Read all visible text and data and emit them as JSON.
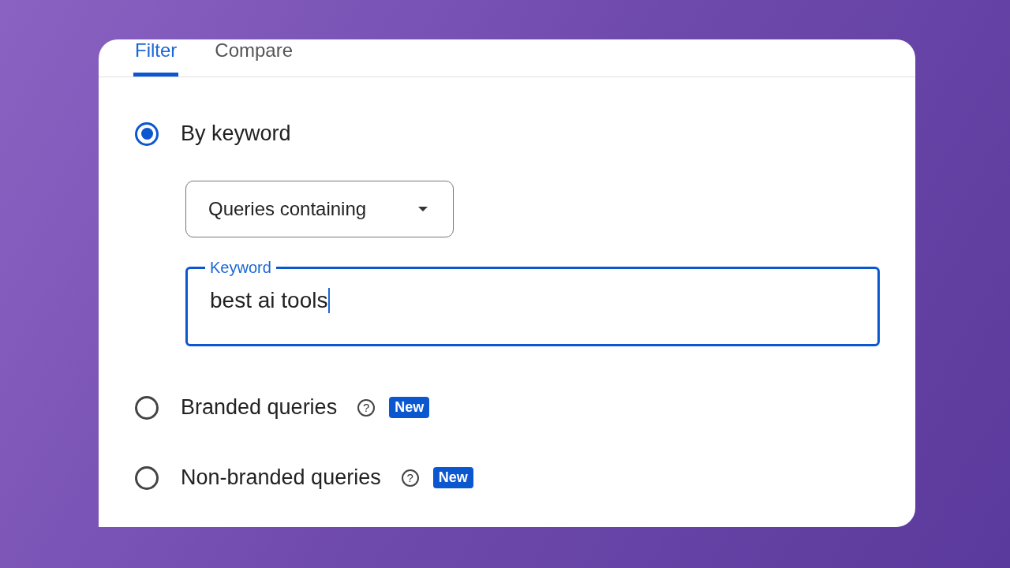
{
  "tabs": [
    {
      "label": "Filter",
      "selected": true
    },
    {
      "label": "Compare",
      "selected": false
    }
  ],
  "options": [
    {
      "label": "By keyword",
      "selected": true,
      "dropdown": {
        "value": "Queries containing"
      },
      "keyword_field": {
        "label": "Keyword",
        "value": "best ai tools",
        "focused": true
      }
    },
    {
      "label": "Branded queries",
      "selected": false,
      "help": "?",
      "badge": "New"
    },
    {
      "label": "Non-branded queries",
      "selected": false,
      "help": "?",
      "badge": "New"
    }
  ]
}
